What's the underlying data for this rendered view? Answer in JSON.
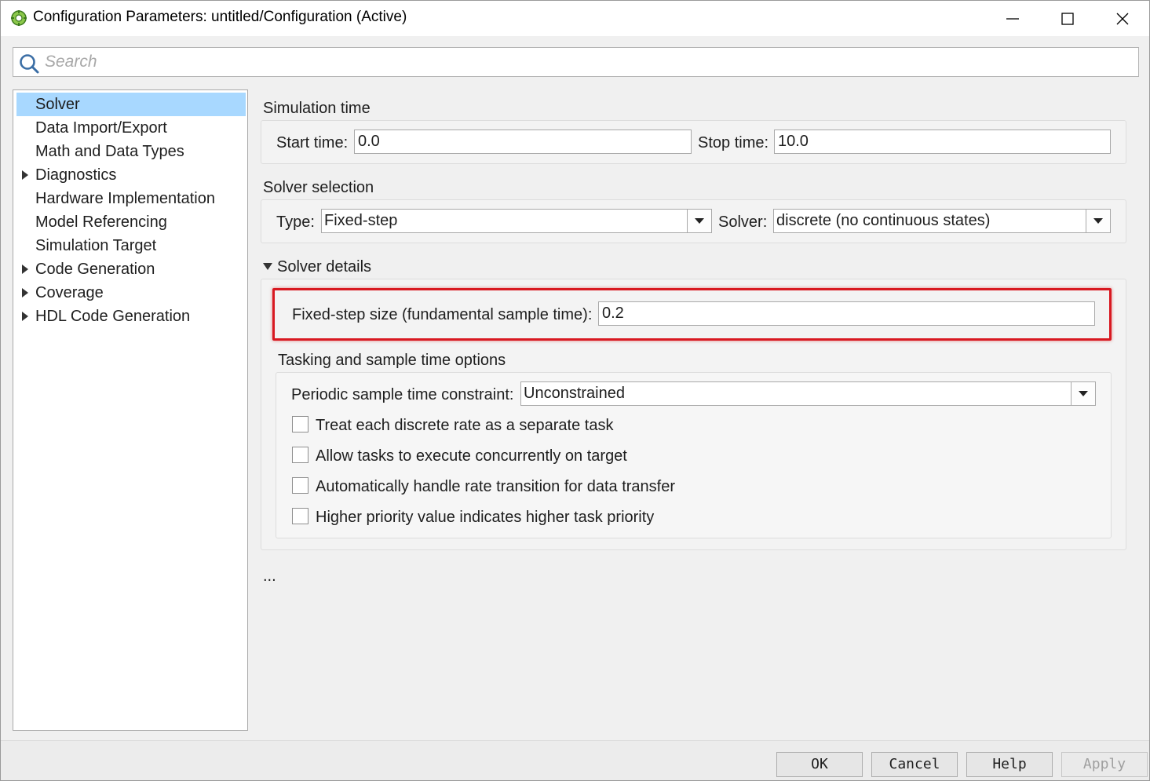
{
  "window": {
    "title": "Configuration Parameters: untitled/Configuration (Active)"
  },
  "search": {
    "placeholder": "Search",
    "value": ""
  },
  "tree": {
    "items": [
      {
        "label": "Solver",
        "selected": true,
        "expandable": false
      },
      {
        "label": "Data Import/Export",
        "selected": false,
        "expandable": false
      },
      {
        "label": "Math and Data Types",
        "selected": false,
        "expandable": false
      },
      {
        "label": "Diagnostics",
        "selected": false,
        "expandable": true
      },
      {
        "label": "Hardware Implementation",
        "selected": false,
        "expandable": false
      },
      {
        "label": "Model Referencing",
        "selected": false,
        "expandable": false
      },
      {
        "label": "Simulation Target",
        "selected": false,
        "expandable": false
      },
      {
        "label": "Code Generation",
        "selected": false,
        "expandable": true
      },
      {
        "label": "Coverage",
        "selected": false,
        "expandable": true
      },
      {
        "label": "HDL Code Generation",
        "selected": false,
        "expandable": true
      }
    ]
  },
  "simulation_time": {
    "title": "Simulation time",
    "start_label": "Start time:",
    "start_value": "0.0",
    "stop_label": "Stop time:",
    "stop_value": "10.0"
  },
  "solver_selection": {
    "title": "Solver selection",
    "type_label": "Type:",
    "type_value": "Fixed-step",
    "solver_label": "Solver:",
    "solver_value": "discrete (no continuous states)"
  },
  "solver_details": {
    "title": "Solver details",
    "step_size_label": "Fixed-step size (fundamental sample time):",
    "step_size_value": "0.2"
  },
  "tasking": {
    "title": "Tasking and sample time options",
    "constraint_label": "Periodic sample time constraint:",
    "constraint_value": "Unconstrained",
    "checkboxes": [
      {
        "label": "Treat each discrete rate as a separate task",
        "checked": false
      },
      {
        "label": "Allow tasks to execute concurrently on target",
        "checked": false
      },
      {
        "label": "Automatically handle rate transition for data transfer",
        "checked": false
      },
      {
        "label": "Higher priority value indicates higher task priority",
        "checked": false
      }
    ]
  },
  "more": {
    "ellipsis": "..."
  },
  "buttons": {
    "ok": "OK",
    "cancel": "Cancel",
    "help": "Help",
    "apply": "Apply"
  },
  "colors": {
    "selection": "#a8d8ff",
    "highlight_box": "#d81921"
  }
}
